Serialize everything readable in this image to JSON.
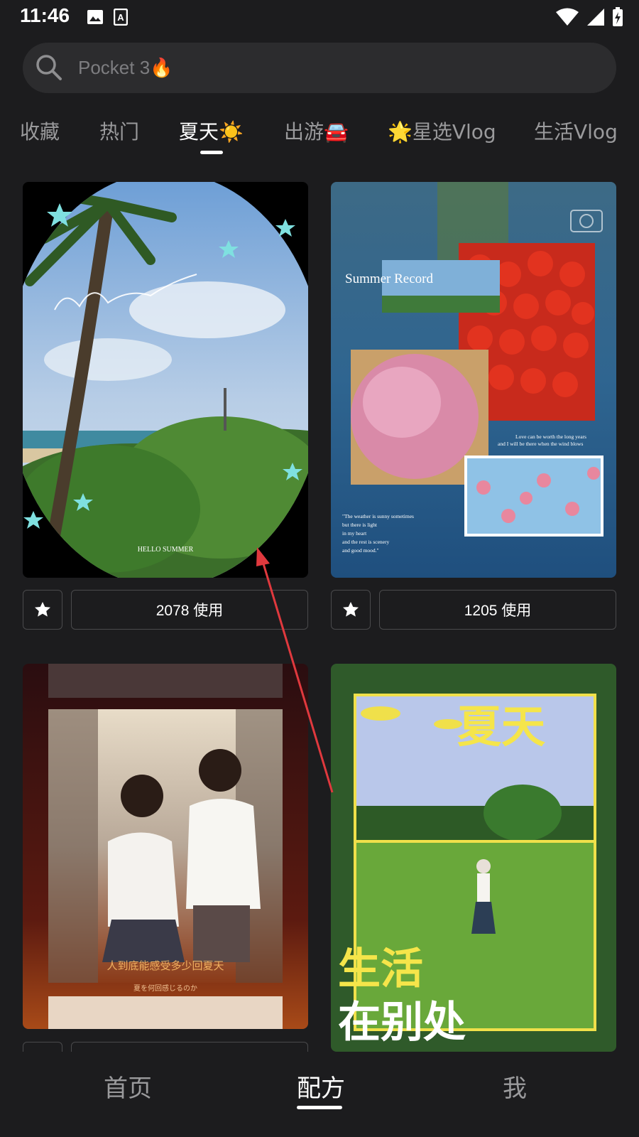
{
  "status_bar": {
    "time": "11:46",
    "icons": [
      "image-icon",
      "a-icon",
      "wifi-icon",
      "signal-icon",
      "battery-icon"
    ]
  },
  "search": {
    "placeholder": "Pocket 3🔥"
  },
  "tabs": [
    {
      "label": "收藏",
      "active": false
    },
    {
      "label": "热门",
      "active": false
    },
    {
      "label": "夏天☀️",
      "active": true
    },
    {
      "label": "出游🚘",
      "active": false
    },
    {
      "label": "🌟星选Vlog",
      "active": false
    },
    {
      "label": "生活Vlog",
      "active": false
    }
  ],
  "cards": [
    {
      "use_label": "2078 使用",
      "image_text": "HELLO SUMMER"
    },
    {
      "use_label": "1205 使用",
      "image_text": "Summer Record",
      "quote_1": "Love can be worth the long years and I will be there when the wind blows",
      "quote_2": "\"The weather is sunny sometimes but there is light in my heart and the rest is scenery and good mood.\""
    },
    {
      "image_text": "人到底能感受多少回夏天",
      "image_subtext": "夏を何回感じるのか"
    },
    {
      "image_text": "夏天",
      "image_subtext_1": "生活",
      "image_subtext_2": "在别处"
    }
  ],
  "bottom_nav": [
    {
      "label": "首页",
      "active": false
    },
    {
      "label": "配方",
      "active": true
    },
    {
      "label": "我",
      "active": false
    }
  ],
  "colors": {
    "background": "#1c1c1e",
    "search_bg": "#2c2c2e",
    "inactive_text": "#9a9a9c",
    "annotation_arrow": "#e0393e"
  }
}
